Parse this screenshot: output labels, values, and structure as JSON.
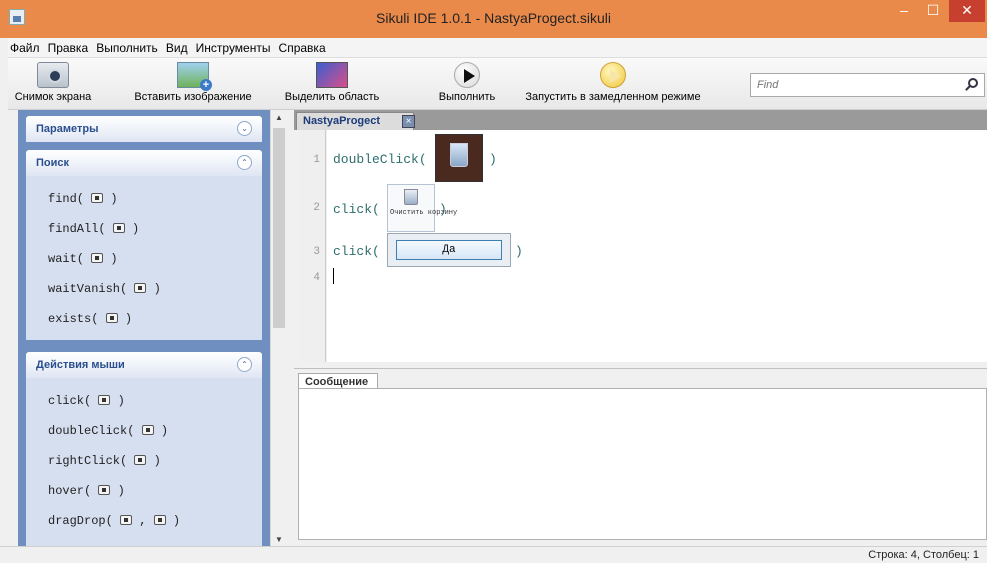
{
  "window": {
    "title": "Sikuli IDE 1.0.1 - NastyaProgect.sikuli",
    "minimize_glyph": "–",
    "maximize_glyph": "☐",
    "close_glyph": "✕",
    "accent_color": "#ea8a4a"
  },
  "menu": {
    "items": [
      "Файл",
      "Правка",
      "Выполнить",
      "Вид",
      "Инструменты",
      "Справка"
    ]
  },
  "toolbar": {
    "screenshot": {
      "label": "Снимок экрана",
      "icon": "camera-icon"
    },
    "insert_image": {
      "label": "Вставить изображение",
      "icon": "insert-image-icon"
    },
    "select_region": {
      "label": "Выделить область",
      "icon": "region-icon"
    },
    "run": {
      "label": "Выполнить",
      "icon": "play-icon"
    },
    "run_slow": {
      "label": "Запустить в замедленном режиме",
      "icon": "slow-play-icon"
    },
    "find_placeholder": "Find"
  },
  "sidebar": {
    "parameters": {
      "title": "Параметры",
      "toggle": "⌄"
    },
    "search": {
      "title": "Поиск",
      "toggle": "⌃",
      "commands": [
        "find(",
        "findAll(",
        "wait(",
        "waitVanish(",
        "exists("
      ]
    },
    "mouse": {
      "title": "Действия мыши",
      "toggle": "⌃",
      "commands": [
        "click(",
        "doubleClick(",
        "rightClick(",
        "hover(",
        "dragDrop("
      ]
    },
    "close_paren": ")",
    "comma": ","
  },
  "editor": {
    "tab_label": "NastyaProgect",
    "tab_close": "×",
    "line_numbers": [
      "1",
      "2",
      "3",
      "4"
    ],
    "lines": [
      {
        "prefix": "doubleClick(",
        "suffix": ")"
      },
      {
        "prefix": "click(",
        "suffix": ")"
      },
      {
        "prefix": "click(",
        "suffix": ")"
      }
    ],
    "image_clear_caption": "Очистить корзину",
    "image_yes_label": "Да"
  },
  "message": {
    "tab_label": "Сообщение"
  },
  "status": {
    "text": "Строка: 4, Столбец: 1"
  }
}
